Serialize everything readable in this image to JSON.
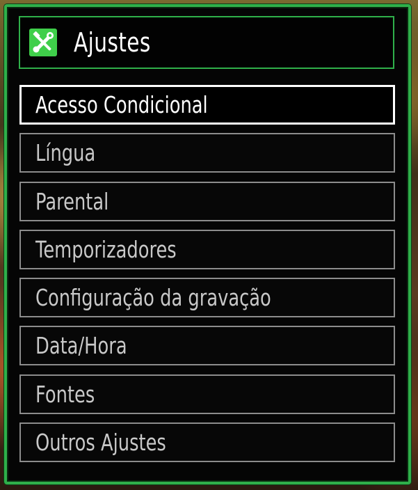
{
  "dialog": {
    "title": "Ajustes",
    "icon": "settings-tools-icon",
    "accent_color": "#2fb04a"
  },
  "menu": {
    "selected_index": 0,
    "items": [
      {
        "label": "Acesso Condicional"
      },
      {
        "label": "Língua"
      },
      {
        "label": "Parental"
      },
      {
        "label": "Temporizadores"
      },
      {
        "label": "Configuração da gravação"
      },
      {
        "label": "Data/Hora"
      },
      {
        "label": "Fontes"
      },
      {
        "label": "Outros Ajustes"
      }
    ]
  }
}
